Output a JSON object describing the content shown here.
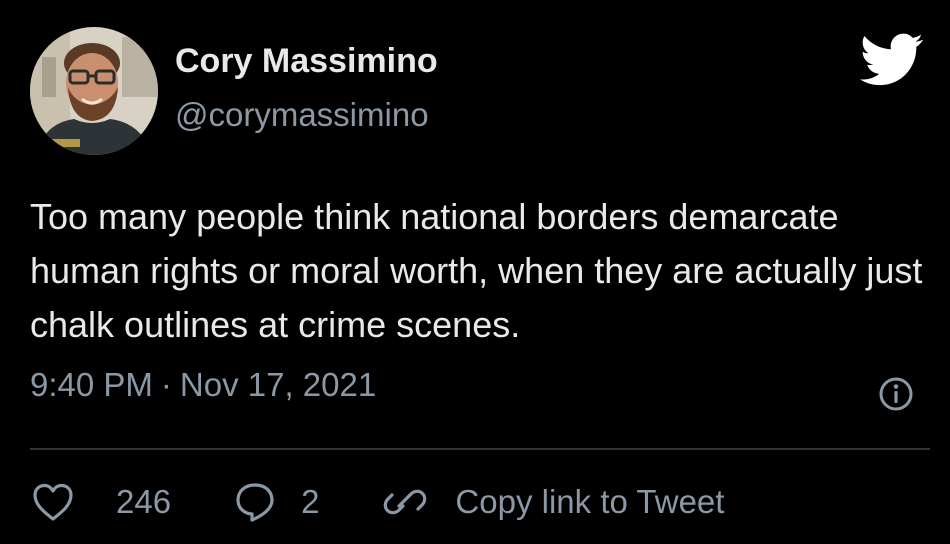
{
  "author": {
    "display_name": "Cory Massimino",
    "handle": "@corymassimino",
    "avatar_icon": "avatar-photo"
  },
  "brand_icon": "twitter-bird-icon",
  "tweet": {
    "text": "Too many people think national borders demarcate human rights or moral worth, when they are actually just chalk outlines at crime scenes.",
    "time": "9:40 PM",
    "separator": "·",
    "date": "Nov 17, 2021"
  },
  "actions": {
    "like_count": "246",
    "reply_count": "2",
    "copy_label": "Copy link to Tweet"
  },
  "colors": {
    "background": "#000000",
    "primary_text": "#e7e9ea",
    "secondary_text": "#8b98a5",
    "divider": "#2f3336"
  }
}
